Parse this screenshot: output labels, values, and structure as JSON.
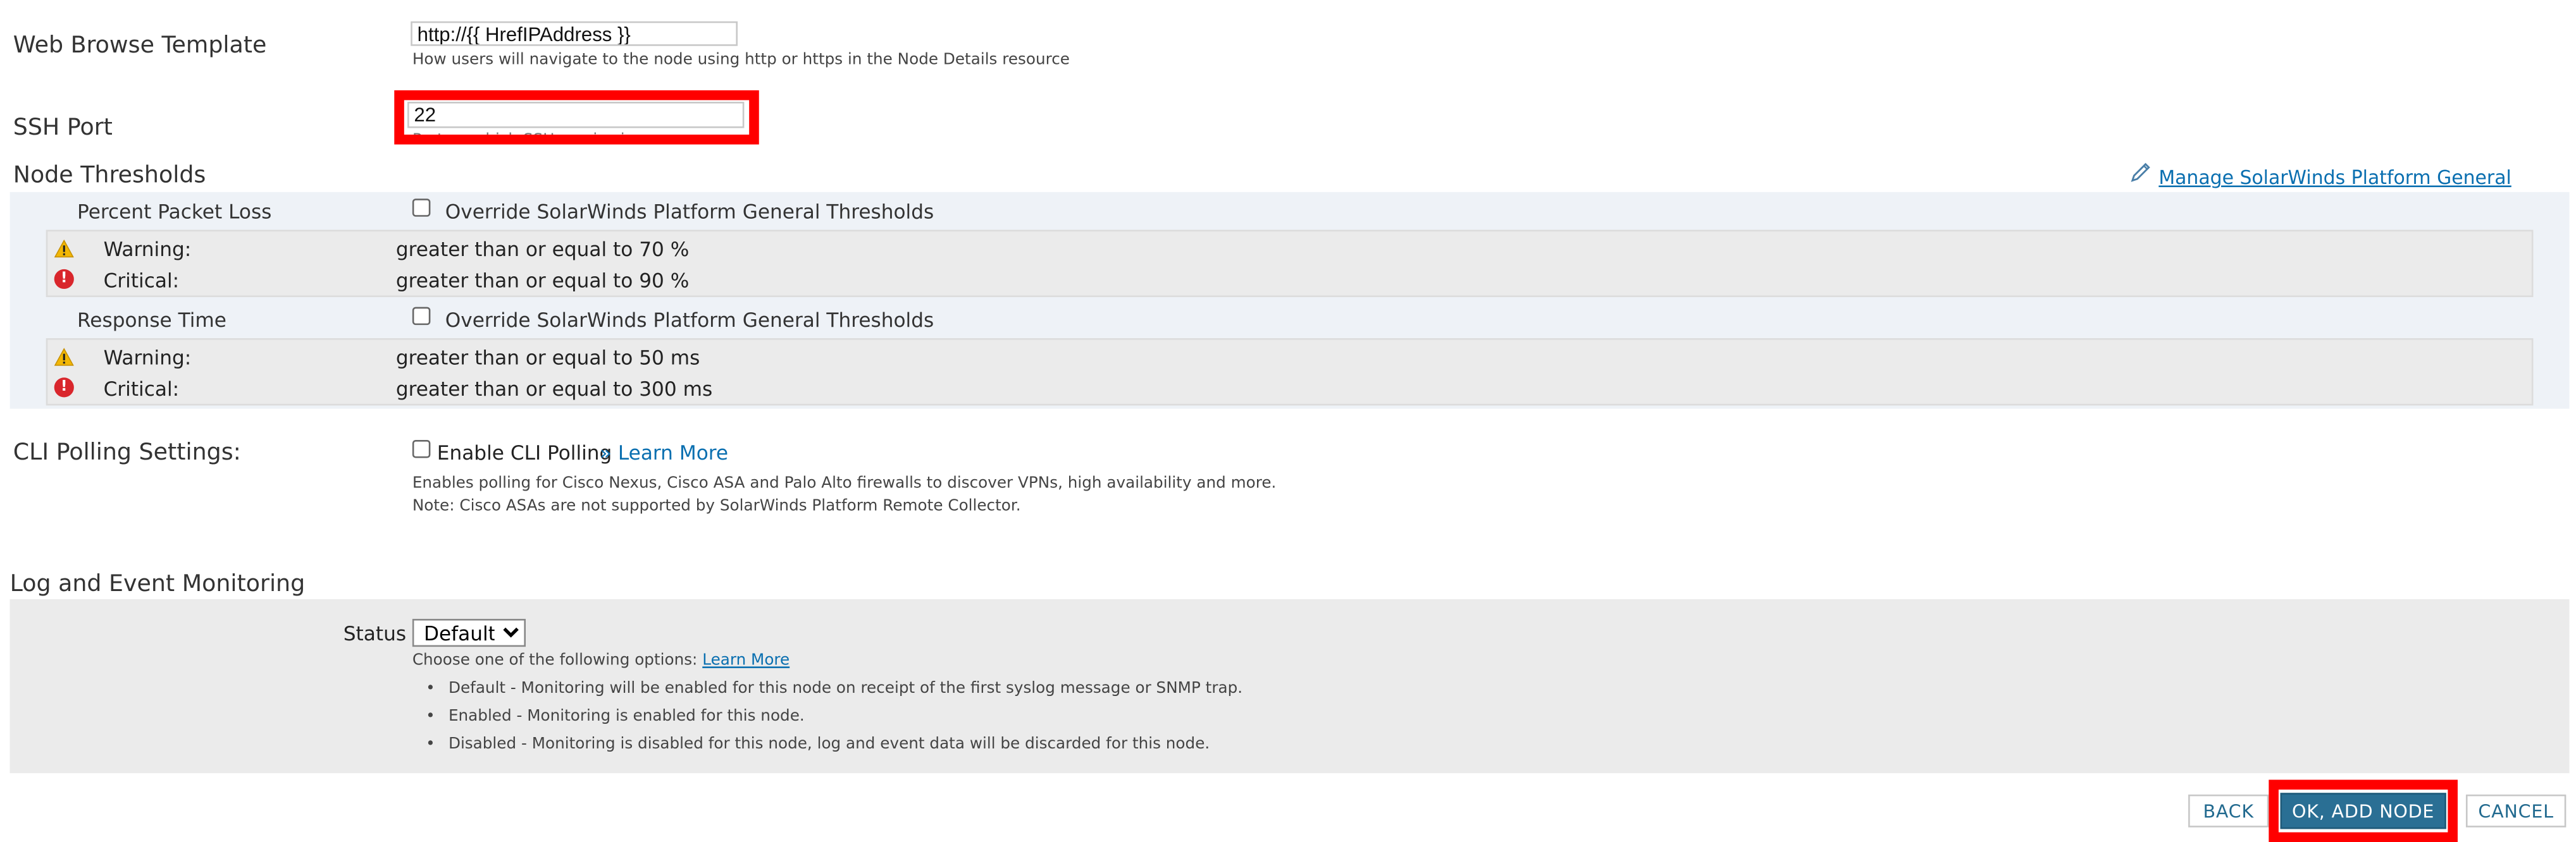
{
  "web_browse": {
    "label": "Web Browse Template",
    "value": "http://{{ HrefIPAddress }}",
    "hint": "How users will navigate to the node using http or https in the Node Details resource"
  },
  "ssh_port": {
    "label": "SSH Port",
    "value": "22",
    "hint_partial": "Port on which SSH service is running"
  },
  "node_thresholds": {
    "heading": "Node Thresholds",
    "manage_link": "Manage SolarWinds Platform General Thresholds",
    "groups": [
      {
        "name": "Percent Packet Loss",
        "override_label": "Override SolarWinds Platform General Thresholds",
        "warning_label": "Warning:",
        "warning_value": "greater than or equal to 70 %",
        "critical_label": "Critical:",
        "critical_value": "greater than or equal to 90 %"
      },
      {
        "name": "Response Time",
        "override_label": "Override SolarWinds Platform General Thresholds",
        "warning_label": "Warning:",
        "warning_value": "greater than or equal to 50 ms",
        "critical_label": "Critical:",
        "critical_value": "greater than or equal to 300 ms"
      }
    ]
  },
  "cli": {
    "label": "CLI Polling Settings:",
    "checkbox_label": "Enable CLI Polling",
    "learn_more": "» Learn More",
    "hint1": "Enables polling for Cisco Nexus, Cisco ASA and Palo Alto firewalls to discover VPNs, high availability and more.",
    "hint2": "Note: Cisco ASAs are not supported by SolarWinds Platform Remote Collector."
  },
  "log_event": {
    "heading": "Log and Event Monitoring",
    "status_label": "Status",
    "status_selected": "Default",
    "choose_text": "Choose one of the following options:",
    "learn_more": "Learn More",
    "bullets": [
      "Default - Monitoring will be enabled for this node on receipt of the first syslog message or SNMP trap.",
      "Enabled - Monitoring is enabled for this node.",
      "Disabled - Monitoring is disabled for this node, log and event data will be discarded for this node."
    ]
  },
  "buttons": {
    "back": "BACK",
    "ok": "OK, ADD NODE",
    "cancel": "CANCEL"
  },
  "colors": {
    "highlight": "#ff0000",
    "link": "#0a6fb0",
    "primary_button": "#2a6f94",
    "critical": "#d9262c",
    "warning": "#f2b705"
  },
  "icons": {
    "pencil": "pencil-icon",
    "warning": "warning-icon",
    "critical": "critical-icon"
  }
}
